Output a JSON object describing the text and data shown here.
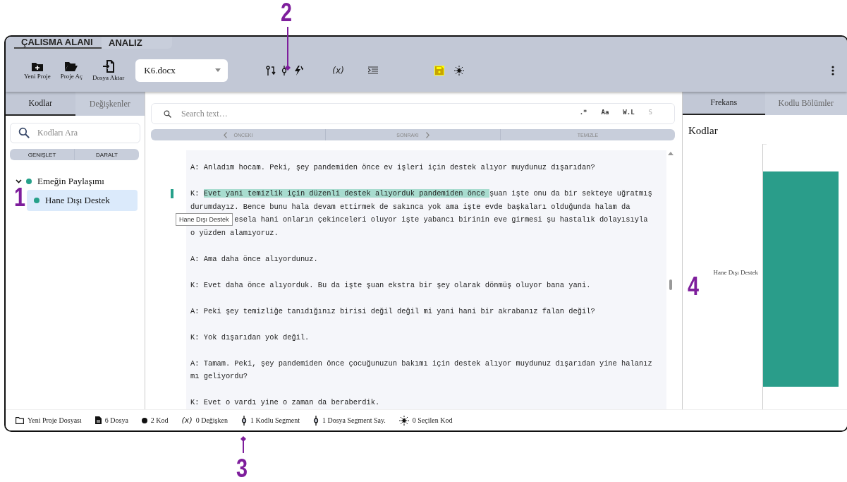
{
  "annotations": [
    {
      "label": "1",
      "kind": "plain"
    },
    {
      "label": "2",
      "kind": "arrow-down"
    },
    {
      "label": "3",
      "kind": "arrow-up"
    },
    {
      "label": "4",
      "kind": "plain"
    }
  ],
  "top_tabs": [
    {
      "label": "ÇALISMA ALANI",
      "selected": true
    },
    {
      "label": "ANALIZ",
      "selected": false
    }
  ],
  "toolbar": {
    "buttons": [
      {
        "label": "Yeni Proje",
        "kind": "new"
      },
      {
        "label": "Proje Aç",
        "kind": "open"
      },
      {
        "label": "Dosya Aktar",
        "kind": "import"
      }
    ],
    "file_select": {
      "value": "K6.docx"
    },
    "variable_button": {
      "label": "(x)"
    },
    "save_button": {
      "highlighted": true
    }
  },
  "sidebar": {
    "tabs": [
      {
        "label": "Kodlar",
        "selected": true
      },
      {
        "label": "Değişkenler",
        "selected": false
      }
    ],
    "search": {
      "placeholder": "Kodları Ara"
    },
    "buttons": [
      "GENIŞLET",
      "DARALT"
    ],
    "tree": [
      {
        "label": "Emeğin Paylaşımı",
        "expanded": true,
        "selected": false,
        "children": [
          {
            "label": "Hane Dışı Destek",
            "selected": true
          }
        ]
      }
    ]
  },
  "document": {
    "search": {
      "placeholder": "Search text…"
    },
    "options": [
      {
        "label": ".*",
        "disabled": false
      },
      {
        "label": "Aa",
        "disabled": false
      },
      {
        "label": "W.L",
        "disabled": false
      },
      {
        "label": "S",
        "disabled": true
      }
    ],
    "nav": [
      {
        "label": "ÖNCEKI",
        "kind": "prev"
      },
      {
        "label": "SONRAKI",
        "kind": "next"
      },
      {
        "label": "TEMIZLE",
        "kind": "clear"
      }
    ],
    "paragraphs": [
      {
        "coded": false,
        "lines": [
          {
            "segments": [
              {
                "text": "A: Anladım hocam. Peki, şey pandemiden önce ev işleri için destek alıyor muydunuz dışarıdan?",
                "coded": false
              }
            ]
          }
        ]
      },
      {
        "coded": true,
        "lines": [
          {
            "segments": [
              {
                "text": "K: ",
                "coded": false
              },
              {
                "text": "Evet yani temizlik için düzenli destek alıyorduk pandemiden önce ",
                "coded": true
              },
              {
                "text": "şuan işte onu da bir sekteye uğratmış",
                "coded": false
              }
            ]
          },
          {
            "segments": [
              {
                "text": "durumdayız. Bence bunu hala devam ettirmek de sakınca yok ama işte evde başkaları olduğunda halam da",
                "coded": false
              }
            ]
          },
          {
            "covered": true,
            "segments": [
              {
                "text": "esela hani onların çekinceleri oluyor işte yabancı birinin eve girmesi şu hastalık dolayısıyla",
                "coded": false
              }
            ]
          },
          {
            "segments": [
              {
                "text": "o yüzden alamıyoruz.",
                "coded": false
              }
            ]
          }
        ]
      },
      {
        "coded": false,
        "lines": [
          {
            "segments": [
              {
                "text": "A: Ama daha önce alıyordunuz.",
                "coded": false
              }
            ]
          }
        ]
      },
      {
        "coded": false,
        "lines": [
          {
            "segments": [
              {
                "text": "K: Evet daha önce alıyorduk. Bu da işte şuan ekstra bir şey olarak dönmüş oluyor bana yani.",
                "coded": false
              }
            ]
          }
        ]
      },
      {
        "coded": false,
        "lines": [
          {
            "segments": [
              {
                "text": "A: Peki şey temizliğe tanıdığınız birisi değil değil mi yani hani bir akrabanız falan değil?",
                "coded": false
              }
            ]
          }
        ]
      },
      {
        "coded": false,
        "lines": [
          {
            "segments": [
              {
                "text": "K: Yok dışarıdan yok değil.",
                "coded": false
              }
            ]
          }
        ]
      },
      {
        "coded": false,
        "lines": [
          {
            "segments": [
              {
                "text": "A: Tamam. Peki, şey pandemiden önce çocuğunuzun bakımı için destek alıyor muydunuz dışarıdan yine halanız",
                "coded": false
              }
            ]
          },
          {
            "segments": [
              {
                "text": "mı geliyordu?",
                "coded": false
              }
            ]
          }
        ]
      },
      {
        "coded": false,
        "lines": [
          {
            "segments": [
              {
                "text": "K: Evet o vardı yine o zaman da beraberdik.",
                "coded": false
              }
            ]
          }
        ]
      }
    ],
    "tooltip": {
      "text": "Hane Dışı Destek"
    }
  },
  "right_panel": {
    "tabs": [
      {
        "label": "Frekans",
        "selected": true
      },
      {
        "label": "Kodlu Bölümler",
        "selected": false
      }
    ],
    "title": "Kodlar",
    "chart_label": "Hane Dışı Destek"
  },
  "status_bar": [
    {
      "kind": "folder",
      "text": "Yeni Proje Dosyası"
    },
    {
      "kind": "file",
      "text": "6 Dosya"
    },
    {
      "kind": "dot",
      "text": "2 Kod"
    },
    {
      "kind": "variable",
      "symbol": "(x)",
      "text": "0 Değişken"
    },
    {
      "kind": "segment",
      "text": "1 Kodlu Segment"
    },
    {
      "kind": "segment",
      "text": "1 Dosya Segment Say."
    },
    {
      "kind": "sparkle",
      "text": "0 Seçilen Kod"
    }
  ]
}
